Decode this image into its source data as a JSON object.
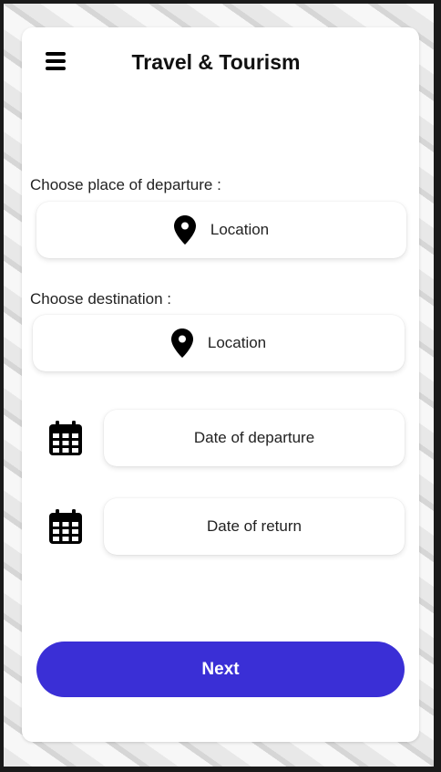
{
  "app": {
    "title": "Travel & Tourism"
  },
  "departure": {
    "label": "Choose place of departure :",
    "value": "Location"
  },
  "destination": {
    "label": "Choose destination :",
    "value": "Location"
  },
  "dates": {
    "departure_placeholder": "Date of departure",
    "return_placeholder": "Date of return"
  },
  "actions": {
    "next_label": "Next"
  },
  "icons": {
    "menu": "hamburger-icon",
    "location": "map-pin-icon",
    "date": "calendar-icon"
  },
  "colors": {
    "primary": "#3a2fd6",
    "text": "#222222"
  }
}
